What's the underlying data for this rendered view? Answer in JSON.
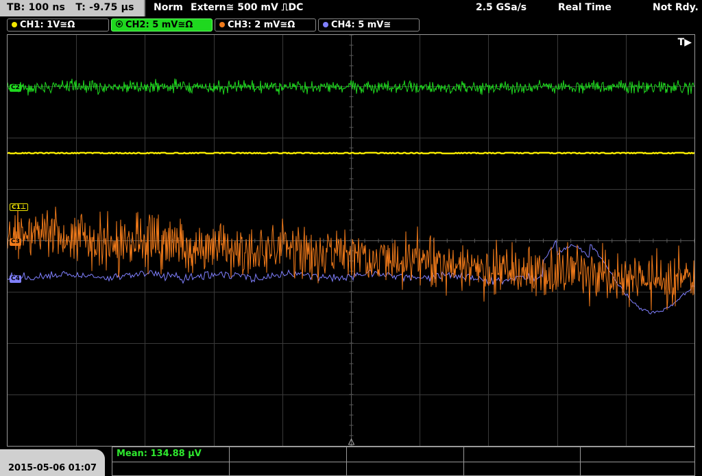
{
  "topbar": {
    "timebase": "TB: 100 ns",
    "trigger_time": "T: -9.75 µs",
    "mode": "Norm",
    "trigger_source": "Extern≅ 500 mV ⎍DC",
    "sample_rate": "2.5 GSa/s",
    "acq_mode": "Real Time",
    "status": "Not Rdy."
  },
  "channels": [
    {
      "label": "CH1: 1V≅Ω",
      "color": "#f2e600",
      "active": false
    },
    {
      "label": "CH2: 5 mV≅Ω",
      "color": "#1fd81f",
      "active": true
    },
    {
      "label": "CH3: 2 mV≅Ω",
      "color": "#f07a1a",
      "active": false
    },
    {
      "label": "CH4: 5 mV≅",
      "color": "#8080ff",
      "active": false
    }
  ],
  "markers": {
    "c2": "C2",
    "c1": "C1⊥",
    "c3": "C3",
    "c4": "C4"
  },
  "trigger_marker": "T▶",
  "bottom": {
    "datetime": "2015-05-06 01:07",
    "measurement": "Mean: 134.88 µV"
  },
  "colors": {
    "ch1": "#f2e600",
    "ch2": "#1fd81f",
    "ch3": "#f07a1a",
    "ch4": "#8080ff",
    "grid": "#3a3a3a"
  }
}
